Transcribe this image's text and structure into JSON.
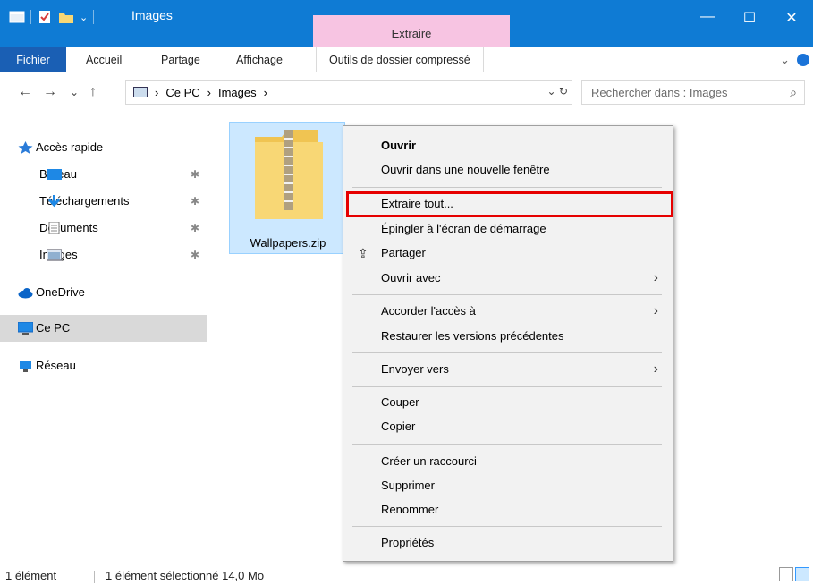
{
  "window": {
    "title": "Images",
    "context_tab_header": "Extraire",
    "controls": {
      "minimize": "—",
      "maximize": "☐",
      "close": "✕"
    }
  },
  "ribbon": {
    "tabs": [
      "Fichier",
      "Accueil",
      "Partage",
      "Affichage",
      "Outils de dossier compressé"
    ]
  },
  "nav": {
    "back": "←",
    "forward": "→",
    "recent": "⌄",
    "up": "↑",
    "breadcrumb": [
      "Ce PC",
      "Images"
    ],
    "breadcrumb_sep": "›",
    "refresh": "↻",
    "dropdown": "⌄",
    "search_placeholder": "Rechercher dans : Images",
    "search_icon_glyph": "⌕"
  },
  "sidebar": {
    "items": [
      {
        "label": "Accès rapide",
        "icon": "star-icon",
        "pinned": false
      },
      {
        "label": "Bureau",
        "icon": "desktop-icon",
        "pinned": true
      },
      {
        "label": "Téléchargements",
        "icon": "download-icon",
        "pinned": true
      },
      {
        "label": "Documents",
        "icon": "document-icon",
        "pinned": true
      },
      {
        "label": "Images",
        "icon": "images-icon",
        "pinned": true
      },
      {
        "label": "OneDrive",
        "icon": "cloud-icon",
        "pinned": false
      },
      {
        "label": "Ce PC",
        "icon": "computer-icon",
        "pinned": false,
        "selected": true
      },
      {
        "label": "Réseau",
        "icon": "network-icon",
        "pinned": false
      }
    ],
    "pin_glyph": "✱"
  },
  "files": [
    {
      "name": "Wallpapers.zip",
      "icon": "zip-folder-icon",
      "selected": true
    }
  ],
  "context_menu": {
    "items": [
      {
        "label": "Ouvrir",
        "bold": true
      },
      {
        "label": "Ouvrir dans une nouvelle fenêtre"
      },
      {
        "label": "Extraire tout...",
        "highlighted": true
      },
      {
        "label": "Épingler à l'écran de démarrage"
      },
      {
        "label": "Partager",
        "icon": "share-icon"
      },
      {
        "label": "Ouvrir avec",
        "submenu": true
      },
      {
        "label": "Accorder l'accès à",
        "submenu": true
      },
      {
        "label": "Restaurer les versions précédentes"
      },
      {
        "label": "Envoyer vers",
        "submenu": true
      },
      {
        "label": "Couper"
      },
      {
        "label": "Copier"
      },
      {
        "label": "Créer un raccourci"
      },
      {
        "label": "Supprimer"
      },
      {
        "label": "Renommer"
      },
      {
        "label": "Propriétés"
      }
    ],
    "submenu_glyph": "›",
    "share_glyph": "⇪"
  },
  "status": {
    "count": "1 élément",
    "selection": "1 élément sélectionné  14,0 Mo"
  },
  "colors": {
    "titlebar": "#0f7bd4",
    "context_tab": "#f7c4e2",
    "file_tab": "#1a5fb4",
    "selection": "#cce8ff",
    "highlight_border": "#e60000"
  }
}
